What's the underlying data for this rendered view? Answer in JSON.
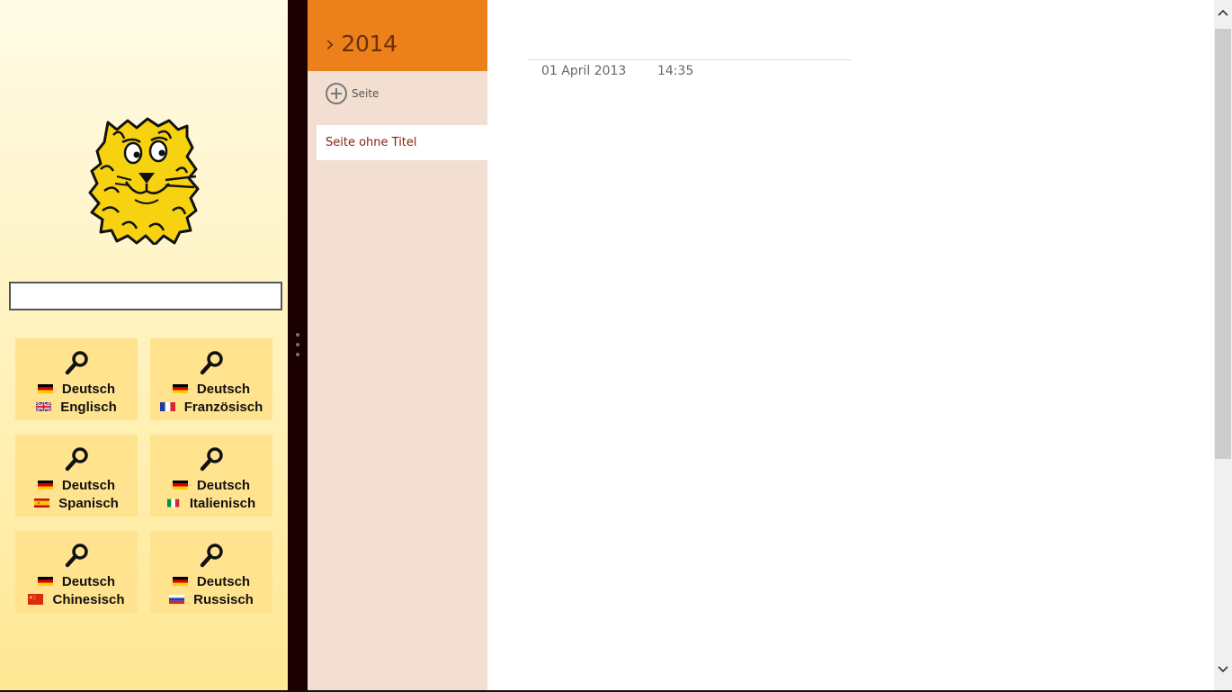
{
  "leo": {
    "search_value": "",
    "search_placeholder": "",
    "tiles": [
      {
        "from": "Deutsch",
        "to": "Englisch",
        "to_flag": "uk-flag-icon"
      },
      {
        "from": "Deutsch",
        "to": "Französisch",
        "to_flag": "france-flag-icon"
      },
      {
        "from": "Deutsch",
        "to": "Spanisch",
        "to_flag": "spain-flag-icon"
      },
      {
        "from": "Deutsch",
        "to": "Italienisch",
        "to_flag": "italy-flag-icon"
      },
      {
        "from": "Deutsch",
        "to": "Chinesisch",
        "to_flag": "china-flag-icon"
      },
      {
        "from": "Deutsch",
        "to": "Russisch",
        "to_flag": "russia-flag-icon"
      }
    ]
  },
  "onenote": {
    "section_title": "› 2014",
    "add_page_label": "Seite",
    "pages": [
      {
        "title": "Seite ohne Titel",
        "selected": true
      }
    ],
    "page": {
      "date": "01 April 2013",
      "time": "14:35"
    }
  },
  "colors": {
    "section_header": "#ec801b",
    "section_pane": "#f2dfd1",
    "tile_bg": "#ffe38e",
    "splitter": "#1a0000",
    "page_title_text": "#8b1a0c"
  }
}
